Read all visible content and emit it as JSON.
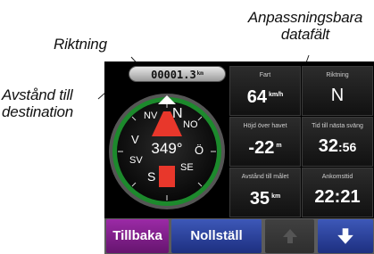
{
  "callouts": {
    "top_right_line1": "Anpassningsbara",
    "top_right_line2": "datafält",
    "riktning": "Riktning",
    "avstand_line1": "Avstånd till",
    "avstand_line2": "destination"
  },
  "odometer": {
    "value": "00001.3",
    "unit": "km"
  },
  "compass": {
    "north": "N",
    "northeast": "NO",
    "northwest": "NV",
    "east": "Ö",
    "west": "V",
    "southeast": "SE",
    "southwest": "SV",
    "south": "S",
    "heading": "349°"
  },
  "fields": [
    {
      "label": "Fart",
      "value": "64",
      "unit": "km/h"
    },
    {
      "label": "Riktning",
      "value": "N",
      "unit": ""
    },
    {
      "label": "Höjd över havet",
      "value": "-22",
      "unit": "m"
    },
    {
      "label": "Tid till nästa sväng",
      "value": "32",
      "seconds": ":56"
    },
    {
      "label": "Avstånd till målet",
      "value": "35",
      "unit": "km"
    },
    {
      "label": "Ankomsttid",
      "value": "22:21",
      "unit": ""
    }
  ],
  "buttons": {
    "back": "Tillbaka",
    "reset": "Nollställ",
    "up_icon": "arrow-up-icon",
    "down_icon": "arrow-down-icon"
  },
  "colors": {
    "compass_ring": "#1c8a2c",
    "needle": "#e8372b",
    "back_button": "#8a2296",
    "primary_button": "#2a3f9e",
    "button_bar": "#5c5c5c"
  }
}
